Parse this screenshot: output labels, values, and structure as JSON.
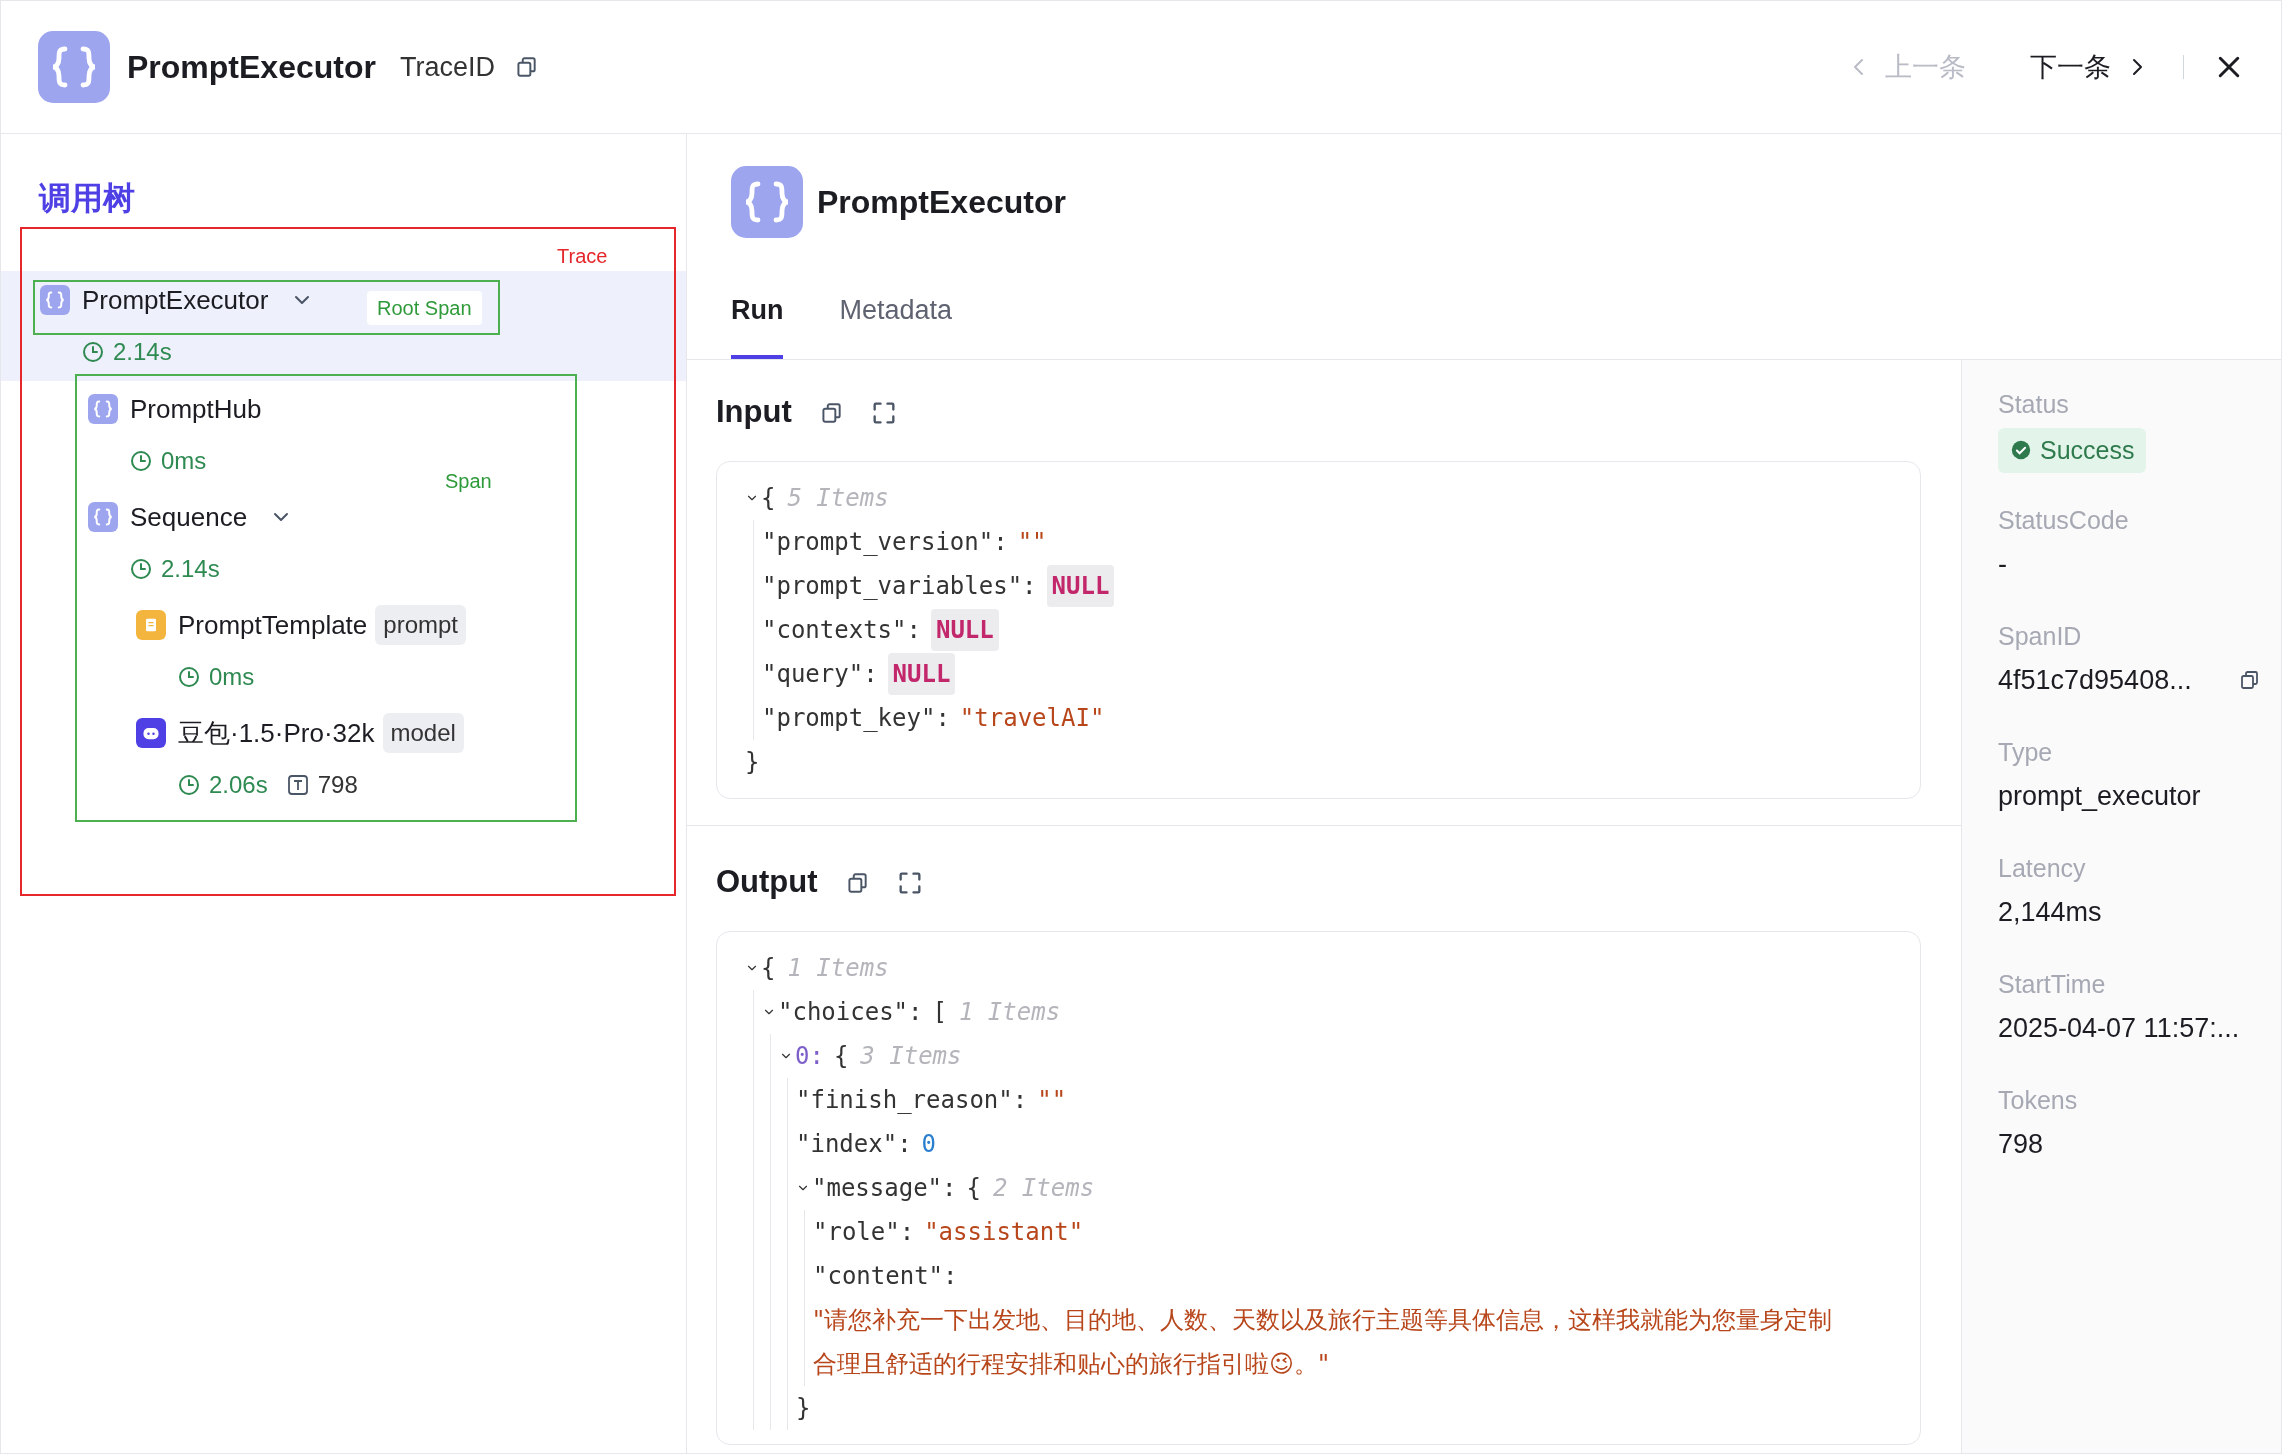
{
  "header": {
    "title": "PromptExecutor",
    "trace_id_label": "TraceID",
    "prev": {
      "label": "上一条",
      "disabled": true
    },
    "next": {
      "label": "下一条",
      "disabled": false
    }
  },
  "tree_panel": {
    "title": "调用树",
    "annotations": {
      "trace_label": "Trace",
      "root_span_label": "Root Span",
      "span_label": "Span"
    },
    "nodes": [
      {
        "name": "PromptExecutor",
        "kind": "code",
        "expanded": true,
        "selected": true,
        "latency": "2.14s",
        "children": [
          {
            "name": "PromptHub",
            "kind": "code",
            "selected": false,
            "latency": "0ms"
          },
          {
            "name": "Sequence",
            "kind": "code",
            "expanded": true,
            "selected": false,
            "latency": "2.14s",
            "children": [
              {
                "name": "PromptTemplate",
                "kind": "prompt",
                "tag": "prompt",
                "selected": false,
                "latency": "0ms"
              },
              {
                "name": "豆包·1.5·Pro·32k",
                "kind": "model",
                "tag": "model",
                "selected": false,
                "latency": "2.06s",
                "tokens": "798"
              }
            ]
          }
        ]
      }
    ]
  },
  "detail": {
    "title": "PromptExecutor",
    "tabs": [
      {
        "label": "Run",
        "selected": true
      },
      {
        "label": "Metadata",
        "selected": false
      }
    ],
    "input": {
      "title": "Input",
      "json": {
        "open": "{",
        "summary": "5 Items",
        "expanded": true,
        "children": [
          {
            "key": "\"prompt_version\":",
            "value": "\"\"",
            "kind": "string"
          },
          {
            "key": "\"prompt_variables\":",
            "value": "NULL",
            "kind": "null"
          },
          {
            "key": "\"contexts\":",
            "value": "NULL",
            "kind": "null"
          },
          {
            "key": "\"query\":",
            "value": "NULL",
            "kind": "null"
          },
          {
            "key": "\"prompt_key\":",
            "value": "\"travelAI\"",
            "kind": "string"
          }
        ],
        "close": "}"
      }
    },
    "output": {
      "title": "Output",
      "json": {
        "open": "{",
        "summary": "1 Items",
        "expanded": true,
        "children": [
          {
            "key": "\"choices\":",
            "kind": "object",
            "open": "[",
            "summary": "1 Items",
            "expanded": true,
            "children": [
              {
                "key": "0:",
                "kind": "index",
                "open": "{",
                "summary": "3 Items",
                "expanded": true,
                "children": [
                  {
                    "key": "\"finish_reason\":",
                    "value": "\"\"",
                    "kind": "string"
                  },
                  {
                    "key": "\"index\":",
                    "value": "0",
                    "kind": "number"
                  },
                  {
                    "key": "\"message\":",
                    "kind": "object",
                    "open": "{",
                    "summary": "2 Items",
                    "expanded": true,
                    "children": [
                      {
                        "key": "\"role\":",
                        "value": "\"assistant\"",
                        "kind": "string"
                      },
                      {
                        "key": "\"content\":",
                        "value": "\"请您补充一下出发地、目的地、人数、天数以及旅行主题等具体信息，这样我就能为您量身定制合理且舒适的行程安排和贴心的旅行指引啦😉。\"",
                        "kind": "longstring"
                      }
                    ],
                    "close": "}"
                  }
                ]
              }
            ]
          }
        ]
      }
    },
    "fields": [
      {
        "label": "Status",
        "value": "Success",
        "kind": "status"
      },
      {
        "label": "StatusCode",
        "value": "-",
        "kind": "text"
      },
      {
        "label": "SpanID",
        "value": "4f51c7d95408...",
        "kind": "copy"
      },
      {
        "label": "Type",
        "value": "prompt_executor",
        "kind": "text"
      },
      {
        "label": "Latency",
        "value": "2,144ms",
        "kind": "text"
      },
      {
        "label": "StartTime",
        "value": "2025-04-07 11:57:...",
        "kind": "text"
      },
      {
        "label": "Tokens",
        "value": "798",
        "kind": "text"
      }
    ]
  }
}
